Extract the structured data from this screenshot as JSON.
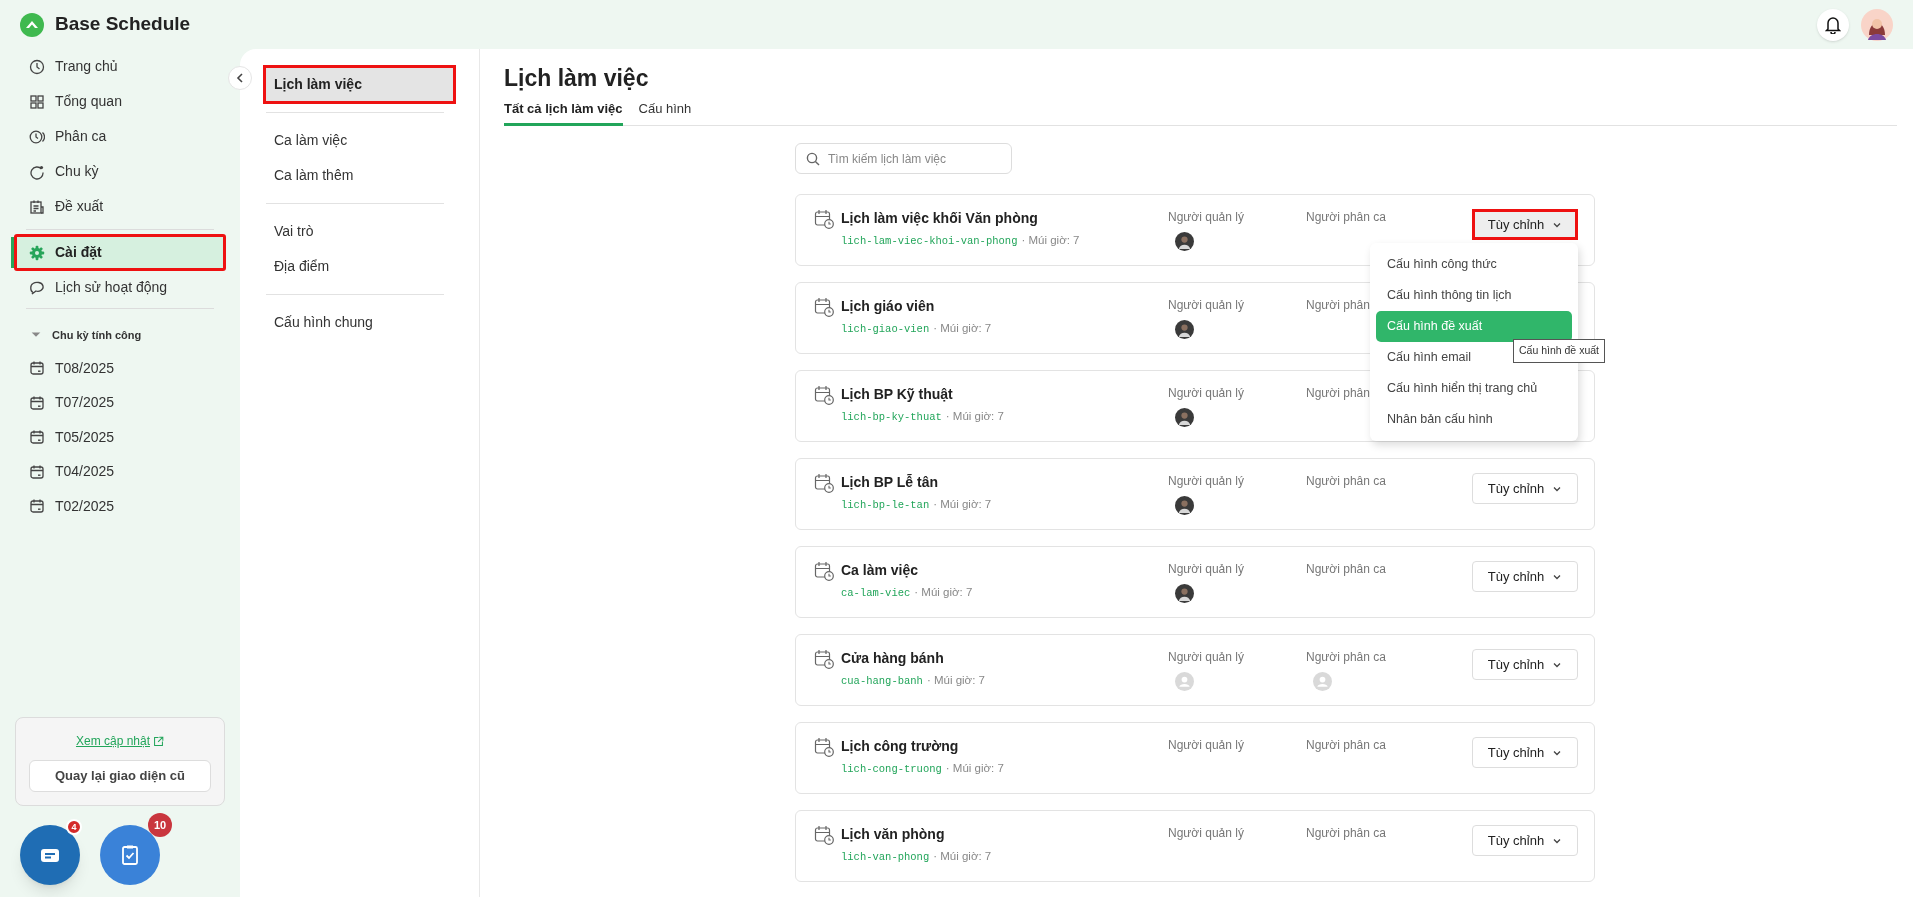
{
  "app": {
    "title": "Base Schedule"
  },
  "sidebar": {
    "items": [
      {
        "label": "Trang chủ",
        "selected": false,
        "highlighted": false
      },
      {
        "label": "Tổng quan",
        "selected": false,
        "highlighted": false
      },
      {
        "label": "Phân ca",
        "selected": false,
        "highlighted": false
      },
      {
        "label": "Chu kỳ",
        "selected": false,
        "highlighted": false
      },
      {
        "label": "Đề xuất",
        "selected": false,
        "highlighted": false
      },
      {
        "label": "Cài đặt",
        "selected": true,
        "highlighted": true
      },
      {
        "label": "Lịch sử hoạt động",
        "selected": false,
        "highlighted": false
      }
    ],
    "section": {
      "label": "Chu kỳ tính công",
      "expanded": true,
      "items": [
        "T08/2025",
        "T07/2025",
        "T05/2025",
        "T04/2025",
        "T02/2025"
      ]
    },
    "update_link": "Xem cập nhật",
    "legacy_button": "Quay lại giao diện cũ"
  },
  "floating_buttons": [
    {
      "kind": "chat",
      "badge": "4"
    },
    {
      "kind": "tasks",
      "badge": "10"
    }
  ],
  "subnav": {
    "groups": [
      [
        {
          "label": "Lịch làm việc",
          "selected": true,
          "highlighted": true
        }
      ],
      [
        {
          "label": "Ca làm việc",
          "selected": false,
          "highlighted": false
        },
        {
          "label": "Ca làm thêm",
          "selected": false,
          "highlighted": false
        }
      ],
      [
        {
          "label": "Vai trò",
          "selected": false,
          "highlighted": false
        },
        {
          "label": "Địa điểm",
          "selected": false,
          "highlighted": false
        }
      ],
      [
        {
          "label": "Cấu hình chung",
          "selected": false,
          "highlighted": false
        }
      ]
    ]
  },
  "page": {
    "title": "Lịch làm việc",
    "tabs": [
      {
        "label": "Tất cả lịch làm việc",
        "selected": true
      },
      {
        "label": "Cấu hình",
        "selected": false
      }
    ],
    "search": {
      "placeholder": "Tìm kiếm lịch làm việc"
    },
    "schedules": [
      {
        "name": "Lịch làm việc khối Văn phòng",
        "slug": "lich-lam-viec-khoi-van-phong",
        "timezone": "· Múi giờ: 7",
        "manager_label": "Người quản lý",
        "assigner_label": "Người phân ca",
        "manager_avatar": {
          "kind": "photo"
        },
        "button": "Tùy chỉnh",
        "highlighted": true,
        "menu_open": true
      },
      {
        "name": "Lịch giáo viên",
        "slug": "lich-giao-vien",
        "timezone": "· Múi giờ: 7",
        "manager_label": "Người quản lý",
        "assigner_label": "Người phân",
        "manager_avatar": {
          "kind": "photo"
        }
      },
      {
        "name": "Lịch BP Kỹ thuật",
        "slug": "lich-bp-ky-thuat",
        "timezone": "· Múi giờ: 7",
        "manager_label": "Người quản lý",
        "assigner_label": "Người phân",
        "manager_avatar": {
          "kind": "photo"
        }
      },
      {
        "name": "Lịch BP Lễ tân",
        "slug": "lich-bp-le-tan",
        "timezone": "· Múi giờ: 7",
        "manager_label": "Người quản lý",
        "assigner_label": "Người phân ca",
        "manager_avatar": {
          "kind": "photo"
        },
        "button": "Tùy chỉnh",
        "highlighted": false,
        "menu_open": false
      },
      {
        "name": "Ca làm việc",
        "slug": "ca-lam-viec",
        "timezone": "· Múi giờ: 7",
        "manager_label": "Người quản lý",
        "assigner_label": "Người phân ca",
        "manager_avatar": {
          "kind": "photo"
        },
        "button": "Tùy chỉnh",
        "highlighted": false,
        "menu_open": false
      },
      {
        "name": "Cửa hàng bánh",
        "slug": "cua-hang-banh",
        "timezone": "· Múi giờ: 7",
        "manager_label": "Người quản lý",
        "assigner_label": "Người phân ca",
        "manager_avatar": {
          "kind": "placeholder"
        },
        "assigner_avatar": {
          "kind": "placeholder"
        },
        "button": "Tùy chỉnh",
        "highlighted": false,
        "menu_open": false
      },
      {
        "name": "Lịch công trường",
        "slug": "lich-cong-truong",
        "timezone": "· Múi giờ: 7",
        "manager_label": "Người quản lý",
        "assigner_label": "Người phân ca",
        "button": "Tùy chỉnh",
        "highlighted": false,
        "menu_open": false
      },
      {
        "name": "Lịch văn phòng",
        "slug": "lich-van-phong",
        "timezone": "· Múi giờ: 7",
        "manager_label": "Người quản lý",
        "assigner_label": "Người phân ca",
        "button": "Tùy chỉnh",
        "highlighted": false,
        "menu_open": false
      }
    ]
  },
  "dropdown": {
    "items": [
      {
        "label": "Cấu hình công thức",
        "selected": false
      },
      {
        "label": "Cấu hình thông tin lịch",
        "selected": false
      },
      {
        "label": "Cấu hình đề xuất",
        "selected": true
      },
      {
        "label": "Cấu hình email",
        "selected": false
      },
      {
        "label": "Cấu hình hiển thị trang chủ",
        "selected": false
      },
      {
        "label": "Nhân bản cấu hình",
        "selected": false
      }
    ],
    "tooltip": "Cấu hình đề xuất"
  }
}
